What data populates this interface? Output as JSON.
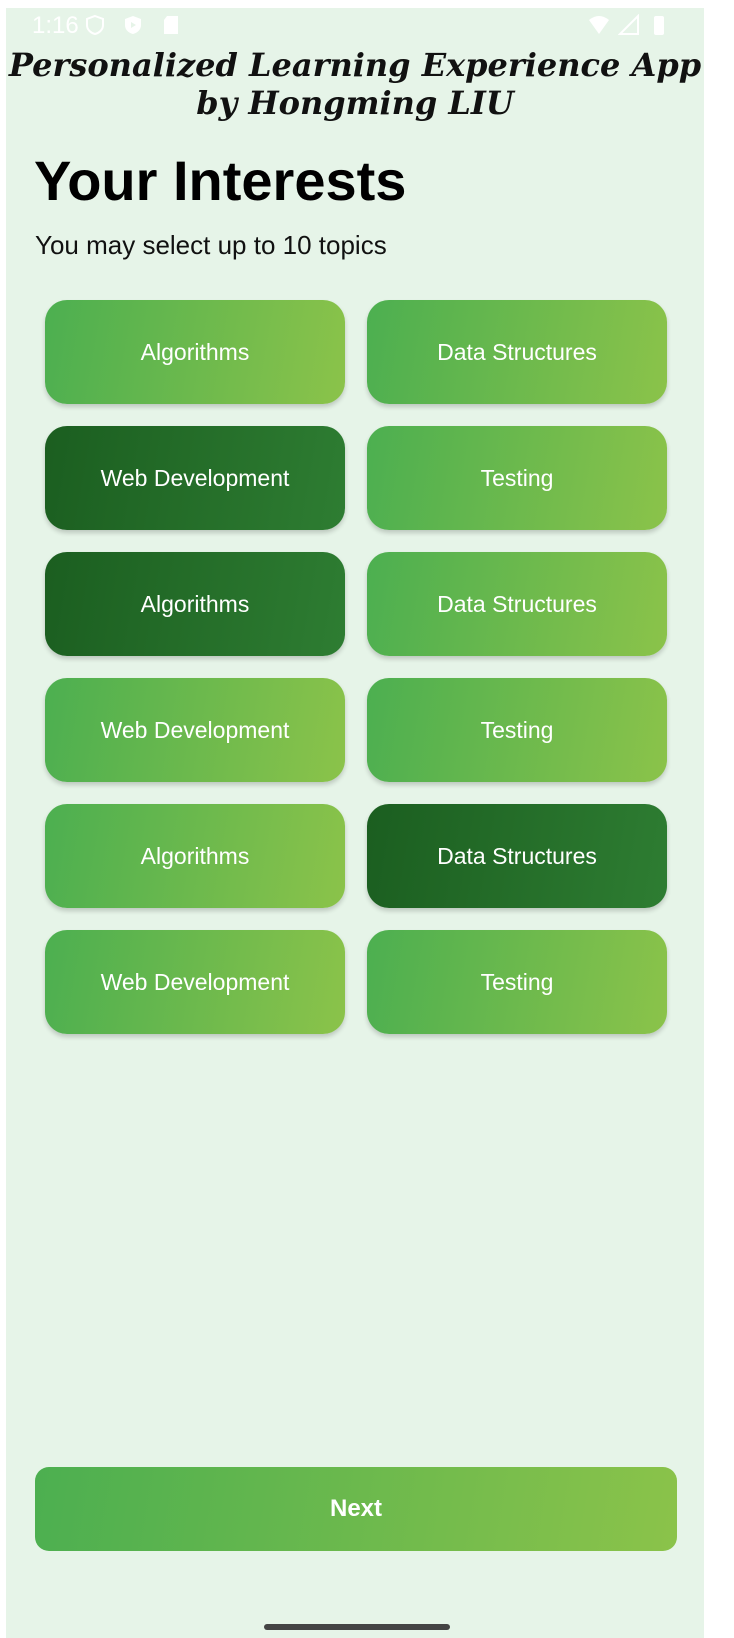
{
  "status_bar": {
    "time": "1:16",
    "icons": [
      "shield-icon",
      "play-protect-icon",
      "sd-card-icon",
      "wifi-icon",
      "signal-icon",
      "battery-icon"
    ]
  },
  "app": {
    "title_line1": "Personalized Learning Experience App",
    "title_line2": "by Hongming LIU"
  },
  "page": {
    "title": "Your Interests",
    "subtitle": "You may select up to 10 topics"
  },
  "topics": [
    {
      "label": "Algorithms",
      "selected": false
    },
    {
      "label": "Data Structures",
      "selected": false
    },
    {
      "label": "Web Development",
      "selected": true
    },
    {
      "label": "Testing",
      "selected": false
    },
    {
      "label": "Algorithms",
      "selected": true
    },
    {
      "label": "Data Structures",
      "selected": false
    },
    {
      "label": "Web Development",
      "selected": false
    },
    {
      "label": "Testing",
      "selected": false
    },
    {
      "label": "Algorithms",
      "selected": false
    },
    {
      "label": "Data Structures",
      "selected": true
    },
    {
      "label": "Web Development",
      "selected": false
    },
    {
      "label": "Testing",
      "selected": false
    }
  ],
  "next_button": {
    "label": "Next"
  },
  "colors": {
    "background": "#e6f4e8",
    "chip_gradient_start": "#4caf50",
    "chip_gradient_end": "#8bc34a",
    "chip_selected_start": "#1b5e20",
    "chip_selected_end": "#2e7d32"
  }
}
